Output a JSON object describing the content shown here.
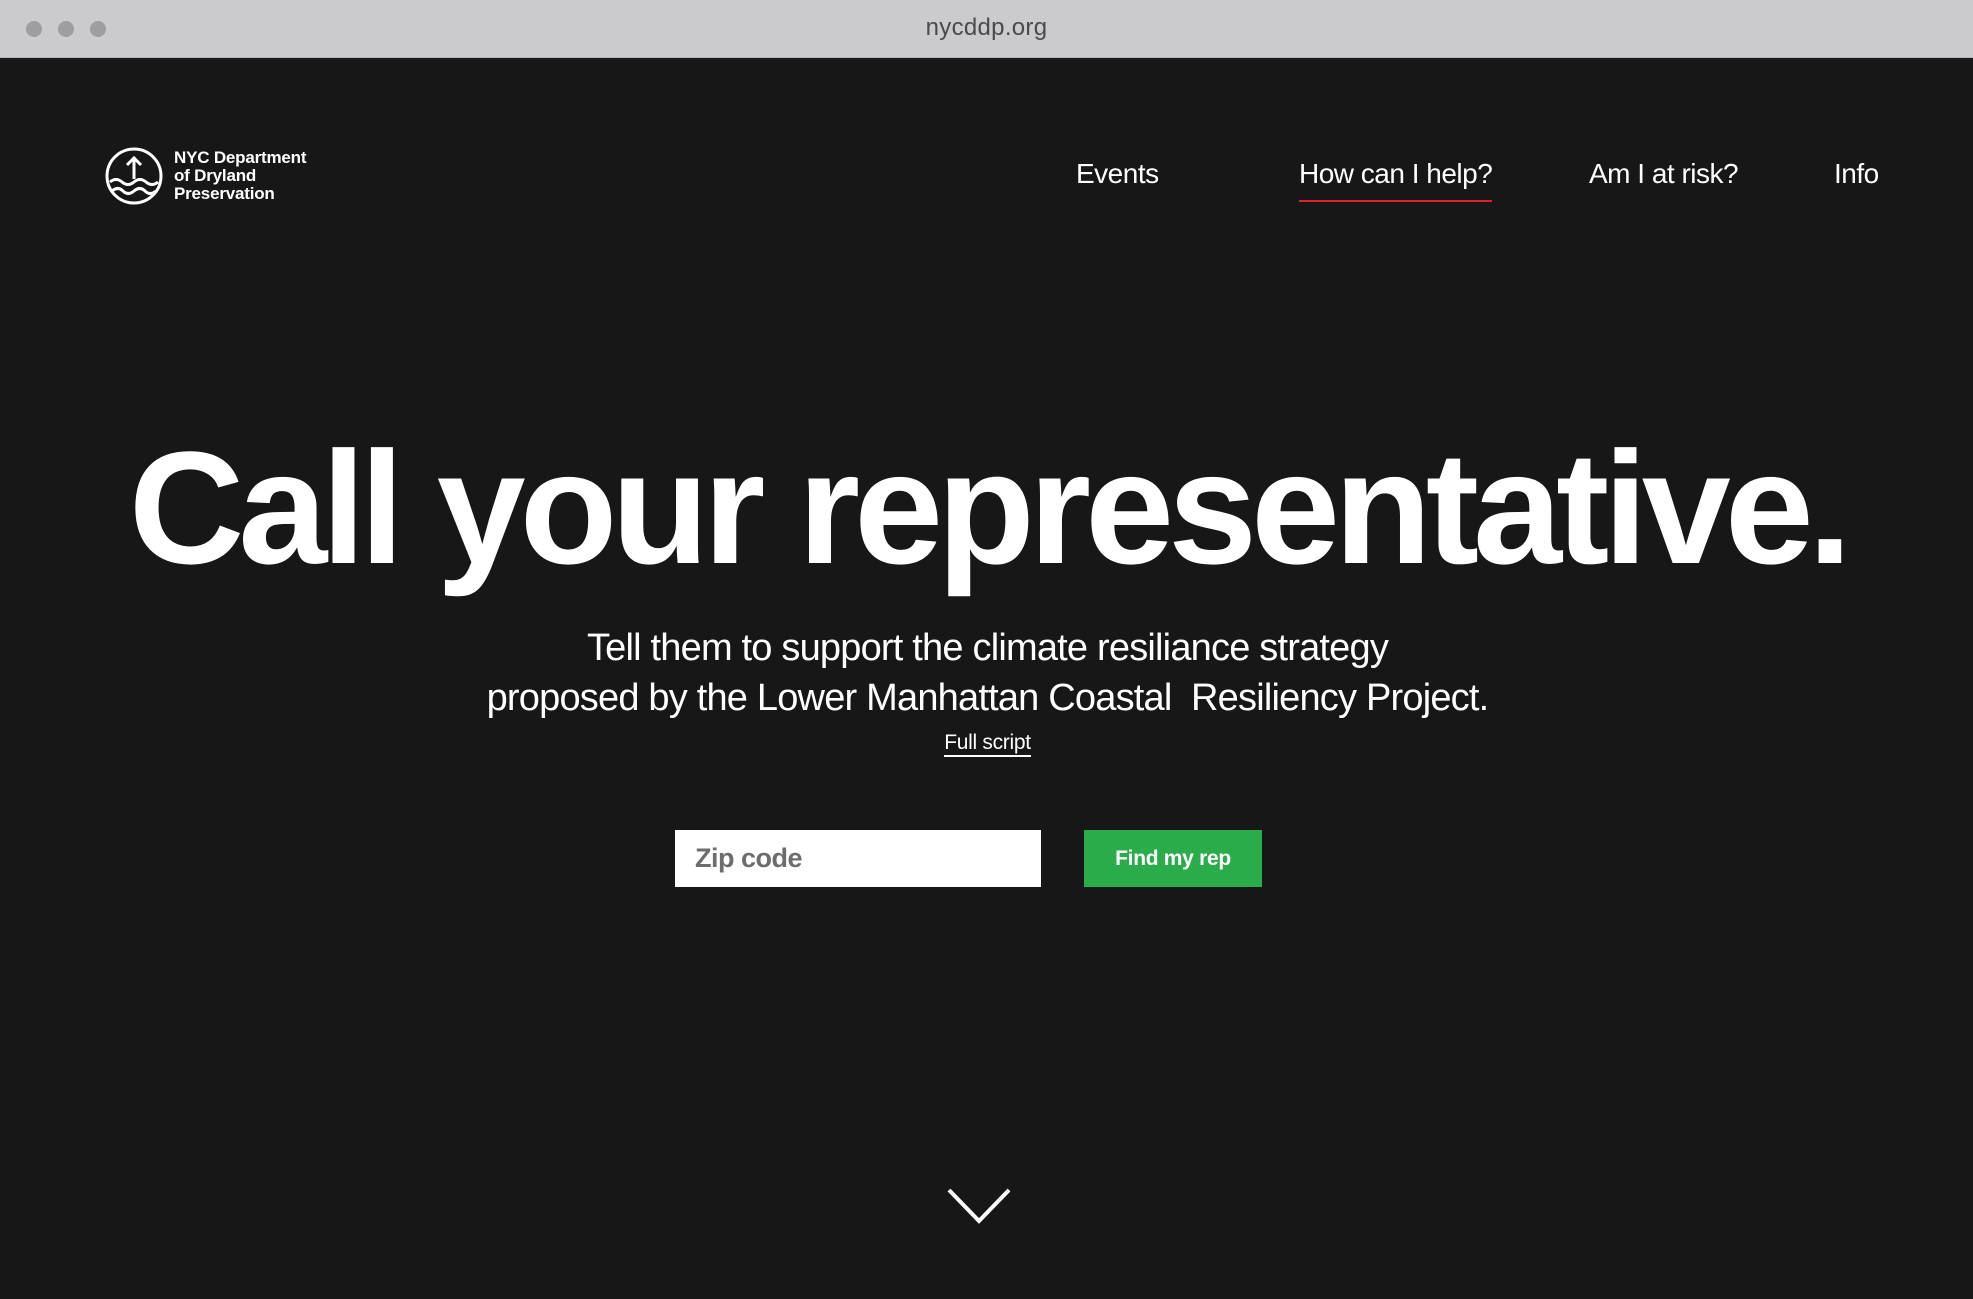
{
  "browser": {
    "url": "nycddp.org"
  },
  "logo": {
    "line1": "NYC Department",
    "line2": "of Dryland",
    "line3": "Preservation"
  },
  "nav": {
    "events": "Events",
    "help": "How can I help?",
    "risk": "Am I at risk?",
    "info": "Info",
    "active": "How can I help?"
  },
  "hero": {
    "headline": "Call your representative.",
    "subhead_line1": "Tell them to support the climate resiliance strategy",
    "subhead_line2": "proposed by the Lower Manhattan Coastal  Resiliency Project.",
    "full_script": "Full script"
  },
  "form": {
    "zip_placeholder": "Zip code",
    "zip_value": "",
    "button_label": "Find my rep"
  },
  "colors": {
    "background": "#171717",
    "accent_underline": "#e0202d",
    "button": "#2bac4a"
  },
  "icons": {
    "logo": "upward-arrow-over-waves-logo",
    "scroll": "chevron-down-icon"
  }
}
